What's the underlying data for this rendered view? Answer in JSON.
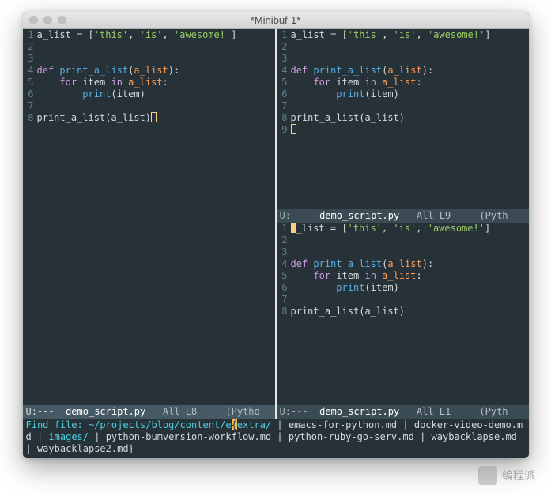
{
  "window_title": "*Minibuf-1*",
  "code": {
    "line1": {
      "var": "a_list",
      "eq": " = ",
      "lb": "[",
      "s1": "'this'",
      "c1": ", ",
      "s2": "'is'",
      "c2": ", ",
      "s3": "'awesome!'",
      "rb": "]"
    },
    "line4": {
      "kw": "def",
      "sp": " ",
      "fn": "print_a_list",
      "lp": "(",
      "arg": "a_list",
      "rp": "):"
    },
    "line5": {
      "kw": "for",
      "sp1": " ",
      "var": "item",
      "sp2": " ",
      "kw2": "in",
      "sp3": " ",
      "arg": "a_list",
      "col": ":"
    },
    "line6": {
      "fn": "print",
      "lp": "(",
      "arg": "item",
      "rp": ")"
    },
    "line8": {
      "call": "print_a_list",
      "lp": "(",
      "arg": "a_list",
      "rp": ")"
    }
  },
  "gutter": {
    "l1": "1",
    "l2": "2",
    "l3": "3",
    "l4": "4",
    "l5": "5",
    "l6": "6",
    "l7": "7",
    "l8": "8",
    "l9": "9"
  },
  "modelines": {
    "left": {
      "u": "U:---  ",
      "name": "demo_script.py",
      "pos": "   All L8     ",
      "mode": "(Pytho"
    },
    "rtop": {
      "u": "U:---  ",
      "name": "demo_script.py",
      "pos": "   All L9     ",
      "mode": "(Pyth"
    },
    "rbot": {
      "u": "U:---  ",
      "name": "demo_script.py",
      "pos": "   All L1     ",
      "mode": "(Pyth"
    }
  },
  "minibuf": {
    "prompt": "Find file: ",
    "path_before": "~/projects/blog/content/e",
    "hl_char": "{",
    "path_after_dir": "extra/",
    "sep": " | ",
    "opt1": "emacs-for-python.md",
    "opt2": "docker-video-demo.md",
    "opt3_dir": "images/",
    "opt4": "python-bumversion-workflow.md",
    "opt5": "python-ruby-go-serv.md",
    "opt6": "waybacklapse.md",
    "opt7": "waybacklapse2.md",
    "close": "}"
  },
  "watermark_text": "编程派"
}
